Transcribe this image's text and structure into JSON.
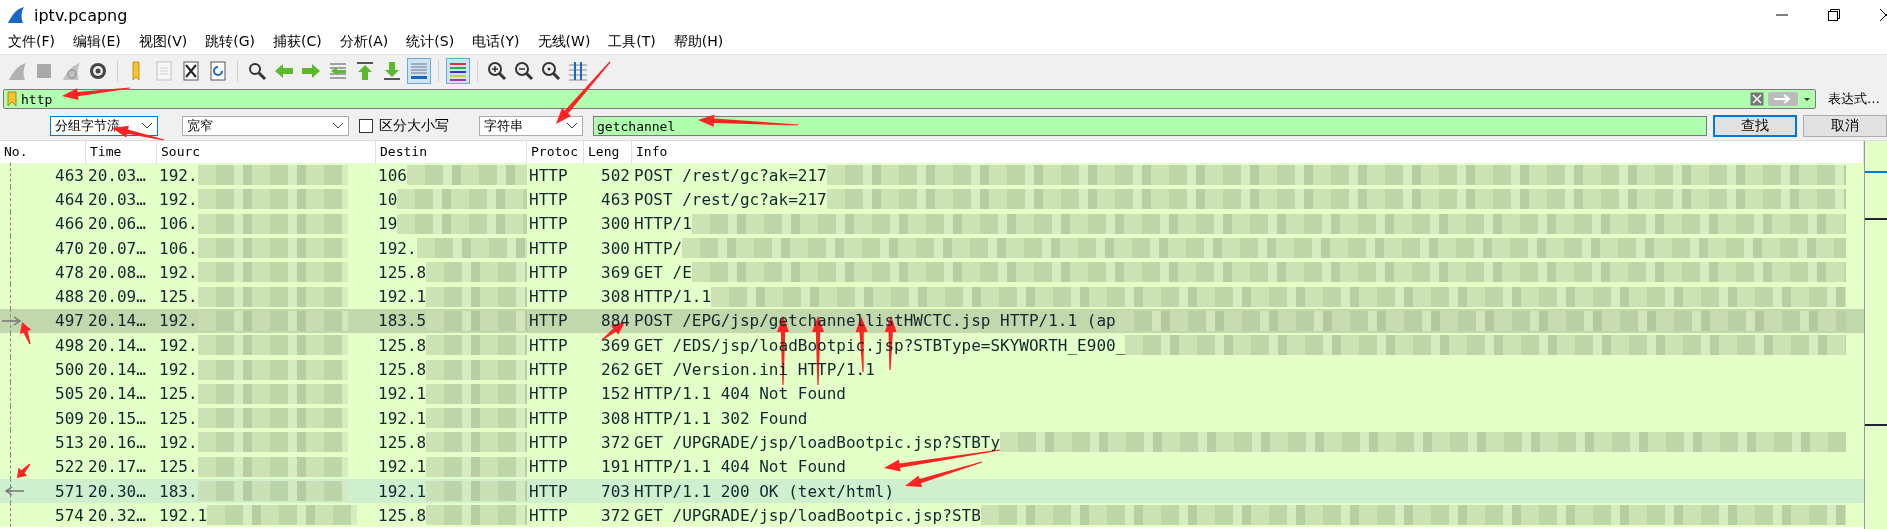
{
  "window": {
    "title": "iptv.pcapng"
  },
  "menu": [
    "文件(F)",
    "编辑(E)",
    "视图(V)",
    "跳转(G)",
    "捕获(C)",
    "分析(A)",
    "统计(S)",
    "电话(Y)",
    "无线(W)",
    "工具(T)",
    "帮助(H)"
  ],
  "toolbar": [
    {
      "kind": "fin",
      "disabled": true,
      "on": false
    },
    {
      "kind": "stop",
      "disabled": true,
      "on": false
    },
    {
      "kind": "restart",
      "disabled": true,
      "on": false
    },
    {
      "kind": "options",
      "disabled": false,
      "on": false
    },
    {
      "kind": "separator"
    },
    {
      "kind": "open",
      "disabled": false,
      "on": false
    },
    {
      "kind": "file",
      "disabled": true,
      "on": false
    },
    {
      "kind": "close",
      "disabled": false,
      "on": false
    },
    {
      "kind": "reload",
      "disabled": false,
      "on": false
    },
    {
      "kind": "separator"
    },
    {
      "kind": "find",
      "disabled": false,
      "on": false
    },
    {
      "kind": "back",
      "disabled": false,
      "on": false
    },
    {
      "kind": "forward",
      "disabled": false,
      "on": false
    },
    {
      "kind": "goto",
      "disabled": false,
      "on": false
    },
    {
      "kind": "first",
      "disabled": false,
      "on": false
    },
    {
      "kind": "last",
      "disabled": false,
      "on": false
    },
    {
      "kind": "autoscroll",
      "disabled": false,
      "on": true
    },
    {
      "kind": "separator"
    },
    {
      "kind": "colorize",
      "disabled": false,
      "on": true
    },
    {
      "kind": "separator"
    },
    {
      "kind": "zoomin",
      "disabled": false,
      "on": false
    },
    {
      "kind": "zoomout",
      "disabled": false,
      "on": false
    },
    {
      "kind": "zoomreset",
      "disabled": false,
      "on": false
    },
    {
      "kind": "resize",
      "disabled": false,
      "on": false
    }
  ],
  "filter": {
    "value": "http",
    "expression_button": "表达式…"
  },
  "find_bar": {
    "search_in": {
      "value": "分组字节流",
      "focused": true
    },
    "charset": {
      "value": "宽窄",
      "focused": false
    },
    "case_sensitive": {
      "label": "区分大小写",
      "checked": false
    },
    "search_type": {
      "value": "字符串",
      "focused": false
    },
    "query": "getchannel",
    "buttons": [
      {
        "label": "查找",
        "default": true
      },
      {
        "label": "取消",
        "default": false
      }
    ]
  },
  "table": {
    "columns": [
      "No.",
      "Time",
      "Sourc",
      "Destin",
      "Protoc",
      "Leng",
      "Info"
    ],
    "rows": [
      {
        "no": "463",
        "time": "20.03…",
        "source": "192.",
        "destination": "106",
        "protocol": "HTTP",
        "length": "502",
        "info": "POST /rest/gc?ak=217",
        "redacted": true,
        "selected": false,
        "request": false,
        "response": false
      },
      {
        "no": "464",
        "time": "20.03…",
        "source": "192.",
        "destination": "10",
        "protocol": "HTTP",
        "length": "463",
        "info": "POST /rest/gc?ak=217",
        "redacted": true,
        "selected": false,
        "request": false,
        "response": false
      },
      {
        "no": "466",
        "time": "20.06…",
        "source": "106.",
        "destination": "19",
        "protocol": "HTTP",
        "length": "300",
        "info": "HTTP/1",
        "redacted": true,
        "selected": false,
        "request": false,
        "response": false
      },
      {
        "no": "470",
        "time": "20.07…",
        "source": "106.",
        "destination": "192.",
        "protocol": "HTTP",
        "length": "300",
        "info": "HTTP/",
        "redacted": true,
        "selected": false,
        "request": false,
        "response": false
      },
      {
        "no": "478",
        "time": "20.08…",
        "source": "192.",
        "destination": "125.8",
        "protocol": "HTTP",
        "length": "369",
        "info": "GET /E",
        "redacted": true,
        "selected": false,
        "request": false,
        "response": false
      },
      {
        "no": "488",
        "time": "20.09…",
        "source": "125.",
        "destination": "192.1",
        "protocol": "HTTP",
        "length": "308",
        "info": "HTTP/1.1",
        "redacted": true,
        "selected": false,
        "request": false,
        "response": false
      },
      {
        "no": "497",
        "time": "20.14…",
        "source": "192.",
        "destination": "183.5",
        "protocol": "HTTP",
        "length": "884",
        "info": "POST /EPG/jsp/getchannellistHWCTC.jsp HTTP/1.1  (ap",
        "redacted": true,
        "selected": true,
        "request": true,
        "response": false
      },
      {
        "no": "498",
        "time": "20.14…",
        "source": "192.",
        "destination": "125.8",
        "protocol": "HTTP",
        "length": "369",
        "info": "GET /EDS/jsp/loadBootpic.jsp?STBType=SKYWORTH_E900_",
        "redacted": true,
        "selected": false,
        "request": false,
        "response": false
      },
      {
        "no": "500",
        "time": "20.14…",
        "source": "192.",
        "destination": "125.8",
        "protocol": "HTTP",
        "length": "262",
        "info": "GET /Version.ini HTTP/1.1",
        "redacted": false,
        "selected": false,
        "request": false,
        "response": false
      },
      {
        "no": "505",
        "time": "20.14…",
        "source": "125.",
        "destination": "192.1",
        "protocol": "HTTP",
        "length": "152",
        "info": "HTTP/1.1 404 Not Found",
        "redacted": false,
        "selected": false,
        "request": false,
        "response": false
      },
      {
        "no": "509",
        "time": "20.15…",
        "source": "125.",
        "destination": "192.1",
        "protocol": "HTTP",
        "length": "308",
        "info": "HTTP/1.1 302 Found",
        "redacted": false,
        "selected": false,
        "request": false,
        "response": false
      },
      {
        "no": "513",
        "time": "20.16…",
        "source": "192.",
        "destination": "125.8",
        "protocol": "HTTP",
        "length": "372",
        "info": "GET /UPGRADE/jsp/loadBootpic.jsp?STBTy",
        "redacted": true,
        "selected": false,
        "request": false,
        "response": false
      },
      {
        "no": "522",
        "time": "20.17…",
        "source": "125.",
        "destination": "192.1",
        "protocol": "HTTP",
        "length": "191",
        "info": "HTTP/1.1 404 Not Found",
        "redacted": false,
        "selected": false,
        "request": false,
        "response": false
      },
      {
        "no": "571",
        "time": "20.30…",
        "source": "183.",
        "destination": "192.1",
        "protocol": "HTTP",
        "length": "703",
        "info": "HTTP/1.1 200 OK  (text/html)",
        "redacted": false,
        "selected": false,
        "request": false,
        "response": true
      },
      {
        "no": "574",
        "time": "20.32…",
        "source": "192.1",
        "destination": "125.8",
        "protocol": "HTTP",
        "length": "372",
        "info": "GET /UPGRADE/jsp/loadBootpic.jsp?STB",
        "redacted": true,
        "selected": false,
        "request": false,
        "response": false
      }
    ]
  }
}
